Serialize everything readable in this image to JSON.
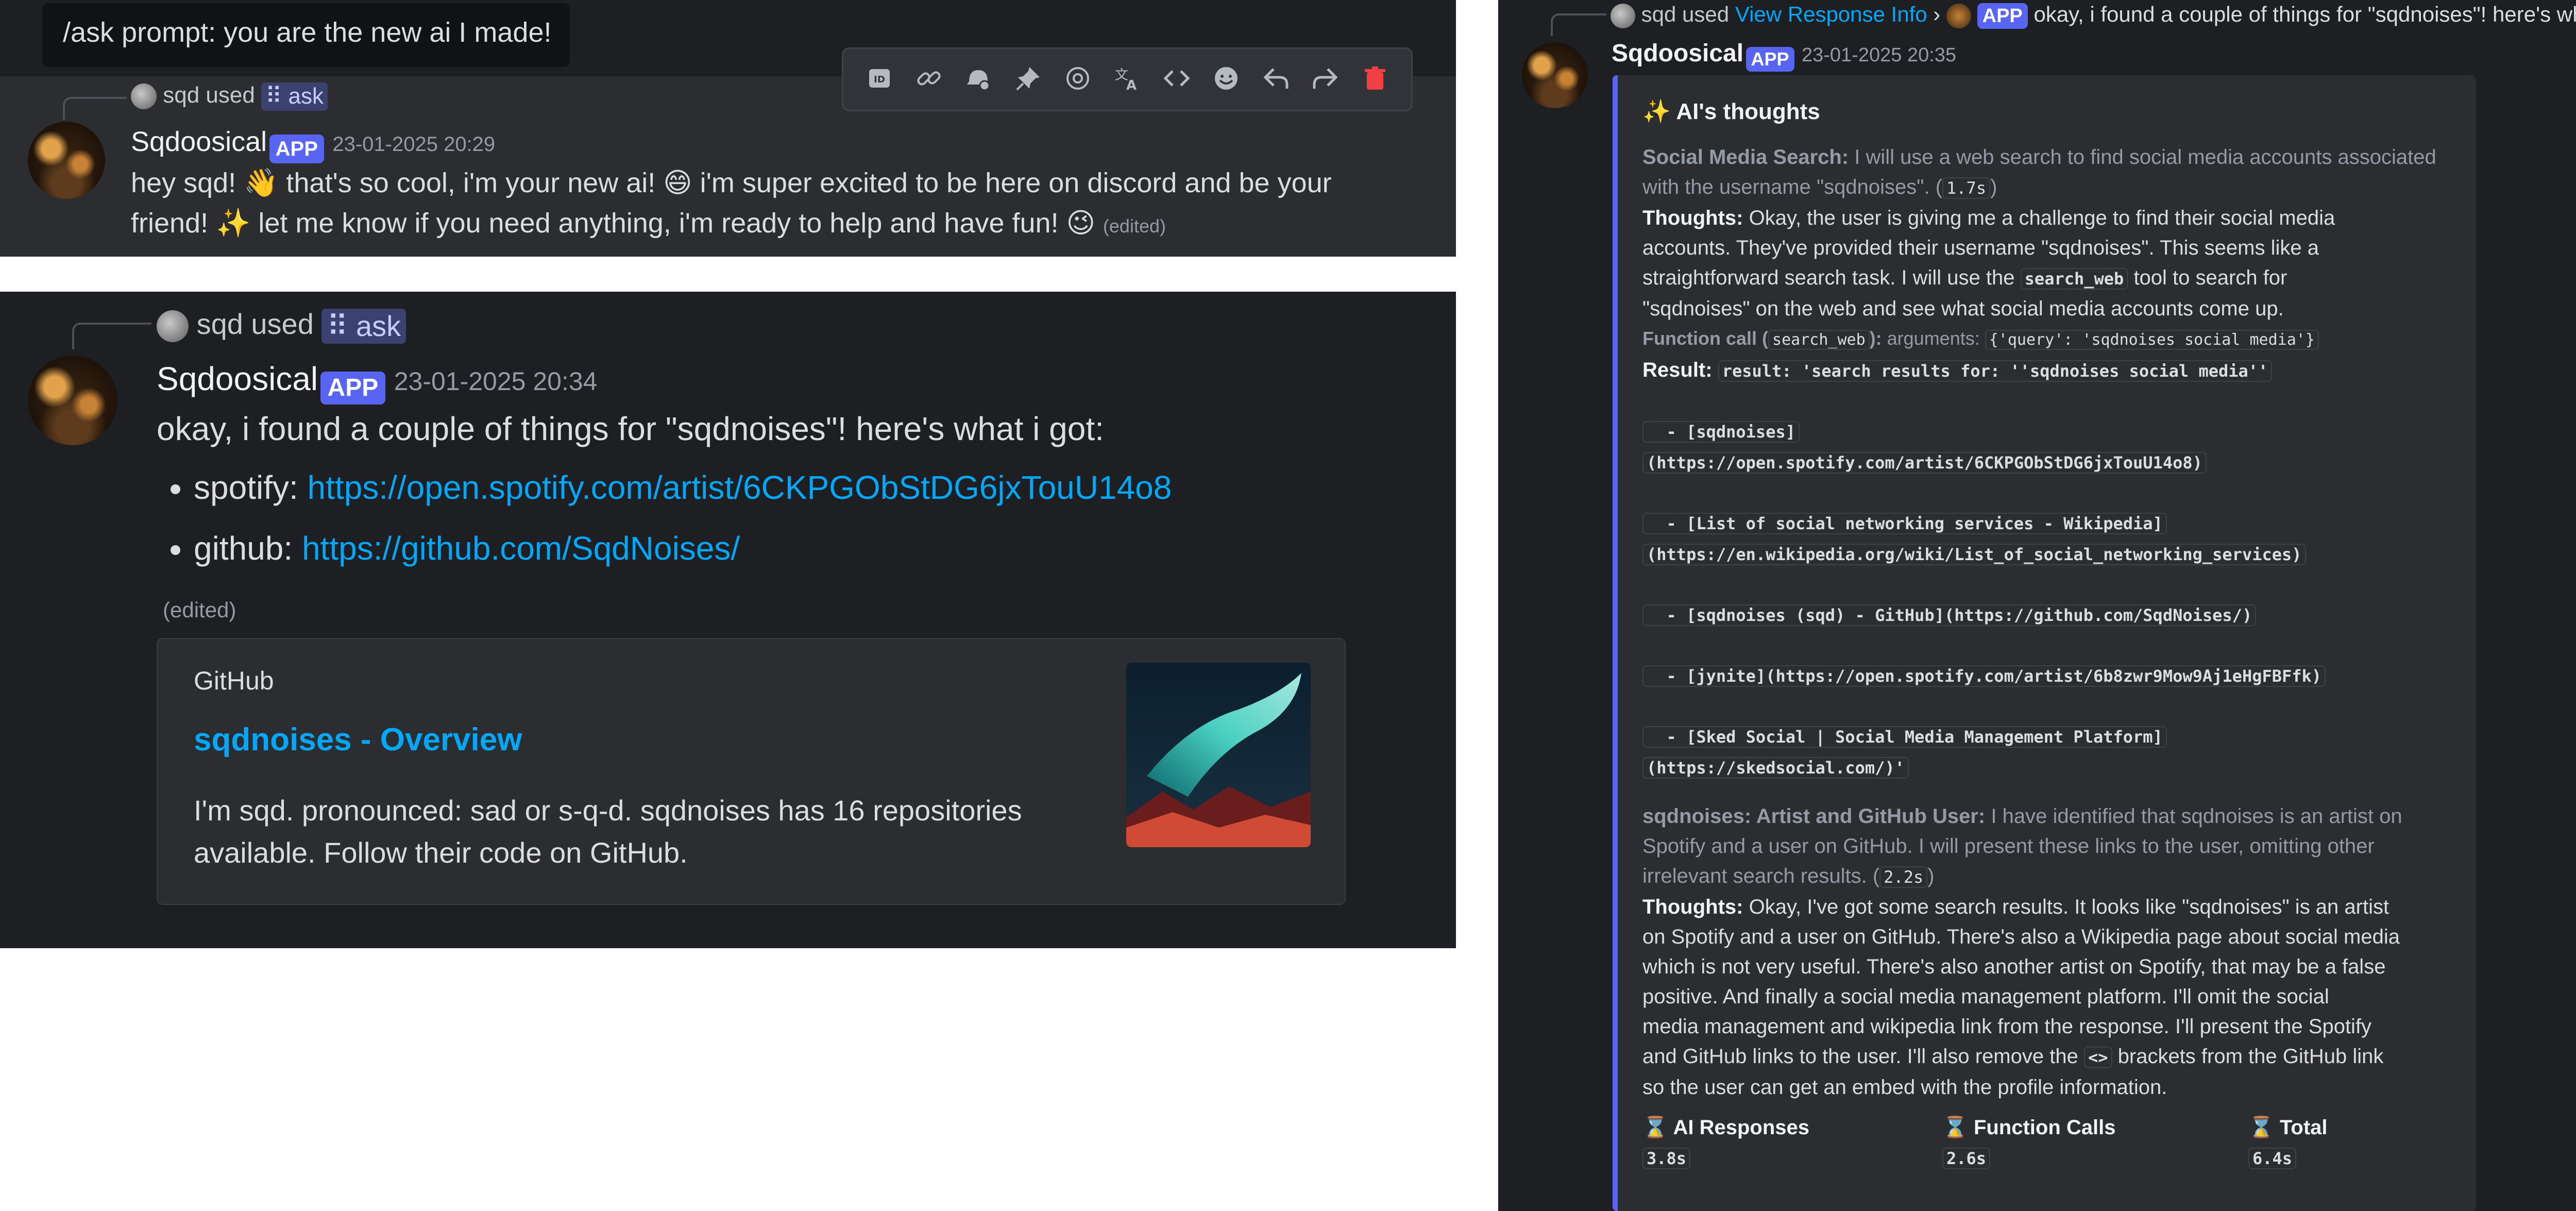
{
  "panel1": {
    "tooltip": "/ask prompt: you are the new ai I made!",
    "reply": {
      "user": "sqd used",
      "command": "ask"
    },
    "author": "Sqdoosical",
    "badge": "APP",
    "timestamp": "23-01-2025 20:29",
    "message_a": "hey sqd! 👋 that's so cool, i'm your new ai! 😄 i'm super excited to be here on discord and be your",
    "message_b": "friend! ✨ let me know if you need anything, i'm ready to help and have fun! 😉",
    "edited": "(edited)",
    "toolbar_icons": [
      "id-icon",
      "link-icon",
      "reminder-icon",
      "pin-icon",
      "mention-icon",
      "translate-icon",
      "code-icon",
      "emoji-icon",
      "reply-icon",
      "forward-icon",
      "delete-icon"
    ]
  },
  "panel2": {
    "reply": {
      "user": "sqd used",
      "command": "ask"
    },
    "author": "Sqdoosical",
    "badge": "APP",
    "timestamp": "23-01-2025 20:34",
    "intro": "okay, i found a couple of things for \"sqdnoises\"! here's what i got:",
    "results": [
      {
        "label": "spotify:",
        "url": "https://open.spotify.com/artist/6CKPGObStDG6jxTouU14o8"
      },
      {
        "label": "github:",
        "url": "https://github.com/SqdNoises/"
      }
    ],
    "edited": "(edited)",
    "embed": {
      "provider": "GitHub",
      "title": "sqdnoises - Overview",
      "description_a": "I'm sqd. pronounced: sad or s-q-d. sqdnoises has 16 repositories",
      "description_b": "available. Follow their code on GitHub."
    }
  },
  "panel3": {
    "reply": {
      "user": "sqd used",
      "link": "View Response Info",
      "sep": "›",
      "badge": "APP",
      "preview": "okay, i found a couple of things for \"sqdnoises\"! here's what i got:"
    },
    "author": "Sqdoosical",
    "badge": "APP",
    "timestamp": "23-01-2025 20:35",
    "thoughts_title": "✨ AI's thoughts",
    "step1": {
      "label": "Social Media Search:",
      "text_a": "I will use a web search to find social media accounts associated",
      "text_b": "with the username \"sqdnoises\". (",
      "time": "1.7s",
      "close": ")"
    },
    "thoughts1": {
      "label": "Thoughts:",
      "line1": "Okay, the user is giving me a challenge to find their social media",
      "line2": "accounts. They've provided their username \"sqdnoises\". This seems like a",
      "line3a": "straightforward search task. I will use the",
      "code": "search_web",
      "line3b": "tool to search for",
      "line4": "\"sqdnoises\" on the web and see what social media accounts come up."
    },
    "function_call": {
      "label": "Function call (",
      "name": "search_web",
      "close": "):",
      "args_label": "arguments:",
      "args": "{'query': 'sqdnoises social media'}"
    },
    "result": {
      "label": "Result:",
      "lines": [
        "result: 'search results for: ''sqdnoises social media''",
        "  - [sqdnoises]",
        "(https://open.spotify.com/artist/6CKPGObStDG6jxTouU14o8)",
        "  - [List of social networking services - Wikipedia]",
        "(https://en.wikipedia.org/wiki/List_of_social_networking_services)",
        "  - [sqdnoises (sqd) - GitHub](https://github.com/SqdNoises/)",
        "  - [jynite](https://open.spotify.com/artist/6b8zwr9Mow9Aj1eHgFBFfk)",
        "  - [Sked Social | Social Media Management Platform]",
        "(https://skedsocial.com/)'"
      ]
    },
    "step2": {
      "label": "sqdnoises: Artist and GitHub User:",
      "text_a": "I have identified that sqdnoises is an artist on",
      "text_b": "Spotify and a user on GitHub. I will present these links to the user, omitting other",
      "text_c": "irrelevant search results. (",
      "time": "2.2s",
      "close": ")"
    },
    "thoughts2": {
      "label": "Thoughts:",
      "line1": "Okay, I've got some search results. It looks like \"sqdnoises\" is an artist",
      "line2": "on Spotify and a user on GitHub. There's also a Wikipedia page about social media",
      "line3": "which is not very useful. There's also another artist on Spotify, that may be a false",
      "line4": "positive. And finally a social media management platform. I'll omit the social",
      "line5": "media management and wikipedia link from the response. I'll present the Spotify",
      "line6a": "and GitHub links to the user. I'll also remove the",
      "code": "<>",
      "line6b": "brackets from the GitHub link",
      "line7": "so the user can get an embed with the profile information."
    },
    "stats": [
      {
        "icon": "⌛",
        "label": "AI Responses",
        "value": "3.8s"
      },
      {
        "icon": "⌛",
        "label": "Function Calls",
        "value": "2.6s"
      },
      {
        "icon": "⌛",
        "label": "Total",
        "value": "6.4s"
      }
    ]
  }
}
